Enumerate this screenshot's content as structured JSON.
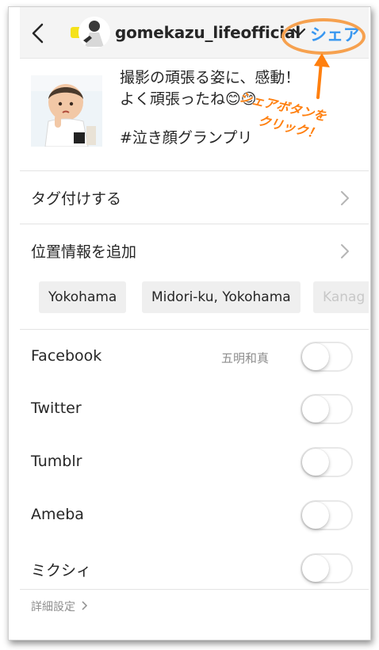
{
  "header": {
    "username": "gomekazu_lifeofficial",
    "share_label": "シェア"
  },
  "annotation": {
    "line1": "シェアボタンを",
    "line2": "クリック！",
    "color": "#ff7f0e"
  },
  "post": {
    "caption_line1": "撮影の頑張る姿に、感動！",
    "caption_line2": "よく頑張ったね😊😊",
    "hashtag": "#泣き顔グランプリ"
  },
  "menu": {
    "tag_people": "タグ付けする",
    "add_location": "位置情報を追加"
  },
  "location_chips": [
    "Yokohama",
    "Midori-ku, Yokohama",
    "Kanag"
  ],
  "share_targets": [
    {
      "name": "Facebook",
      "account": "五明和真",
      "enabled": false
    },
    {
      "name": "Twitter",
      "account": "",
      "enabled": false
    },
    {
      "name": "Tumblr",
      "account": "",
      "enabled": false
    },
    {
      "name": "Ameba",
      "account": "",
      "enabled": false
    },
    {
      "name": "ミクシィ",
      "account": "",
      "enabled": false
    }
  ],
  "advanced_settings": "詳細設定",
  "colors": {
    "accent": "#3897f0",
    "highlight": "#f6a14f"
  }
}
